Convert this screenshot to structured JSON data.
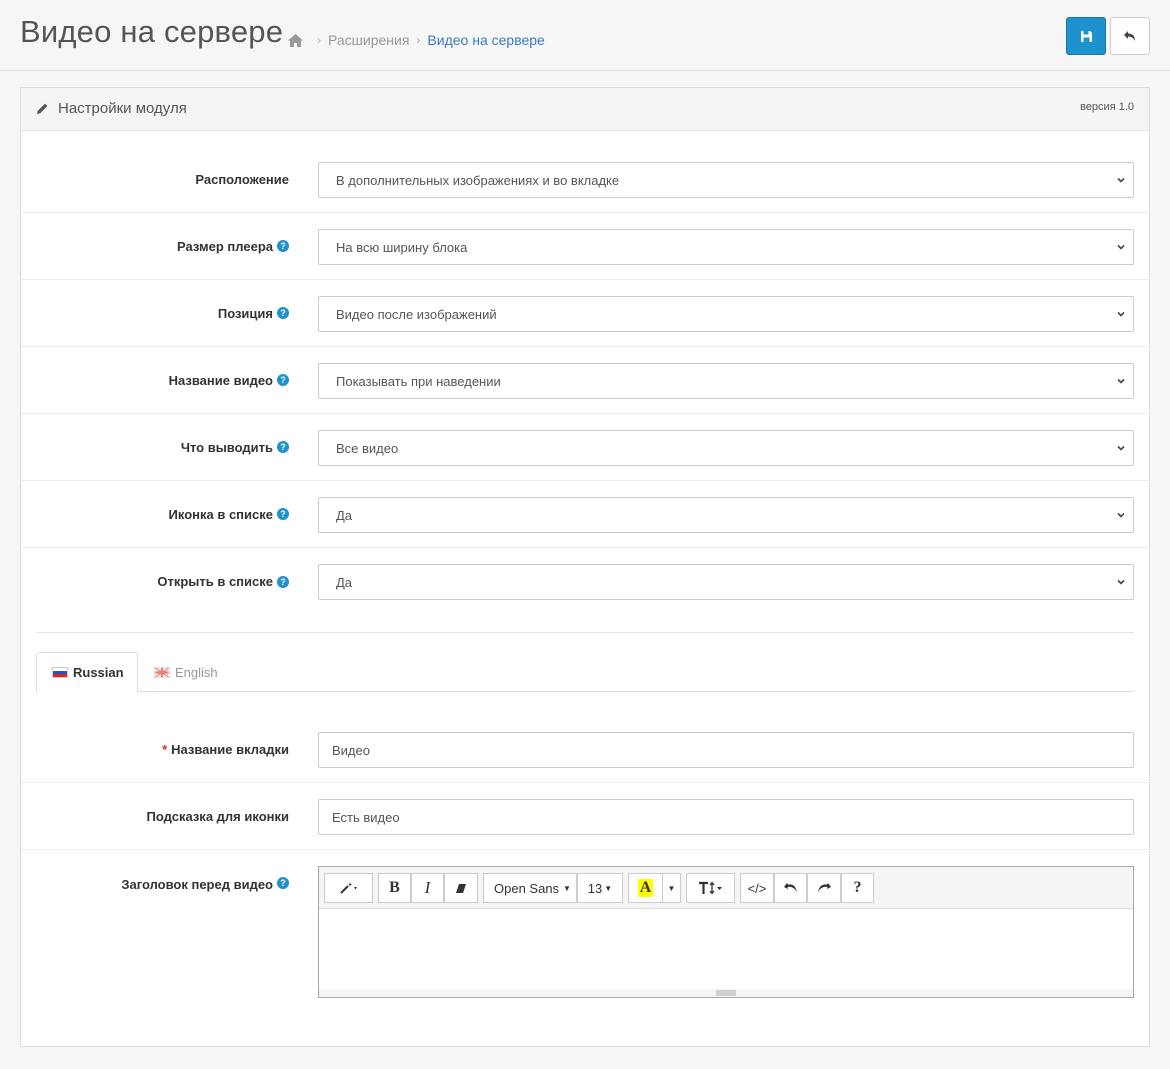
{
  "header": {
    "title": "Видео на сервере",
    "breadcrumb": {
      "sep": "›",
      "items": [
        "Расширения",
        "Видео на сервере"
      ]
    },
    "save_icon": "floppy-disk-icon",
    "back_icon": "reply-icon",
    "save_color": "#1e91cf"
  },
  "panel": {
    "title": "Настройки модуля",
    "title_icon": "pencil-icon",
    "version": "версия 1.0"
  },
  "settings": [
    {
      "label": "Расположение",
      "value": "В дополнительных изображениях и во вкладке",
      "help": false
    },
    {
      "label": "Размер плеера",
      "value": "На всю ширину блока",
      "help": true
    },
    {
      "label": "Позиция",
      "value": "Видео после изображений",
      "help": true
    },
    {
      "label": "Название видео",
      "value": "Показывать при наведении",
      "help": true
    },
    {
      "label": "Что выводить",
      "value": "Все видео",
      "help": true
    },
    {
      "label": "Иконка в списке",
      "value": "Да",
      "help": true
    },
    {
      "label": "Открыть в списке",
      "value": "Да",
      "help": true
    }
  ],
  "help_glyph": "?",
  "language_tabs": [
    {
      "label": "Russian",
      "active": true,
      "flag": "ru-flag-icon"
    },
    {
      "label": "English",
      "active": false,
      "flag": "gb-flag-icon"
    }
  ],
  "lang_fields": {
    "tab_name": {
      "required_mark": "*",
      "label": "Название вкладки",
      "value": "Видео"
    },
    "icon_hint": {
      "label": "Подсказка для иконки",
      "value": "Есть видео"
    },
    "heading": {
      "label": "Заголовок перед видео"
    }
  },
  "editor_toolbar": {
    "style_icon": "magic-wand-icon",
    "bold": "B",
    "italic": "I",
    "eraser_icon": "eraser-icon",
    "font_family": "Open Sans",
    "font_size": "13",
    "color_letter": "A",
    "color_highlight": "#ffff00",
    "text_height_icon": "text-height-icon",
    "code": "</>",
    "undo_icon": "undo-icon",
    "redo_icon": "redo-icon",
    "help": "?"
  }
}
